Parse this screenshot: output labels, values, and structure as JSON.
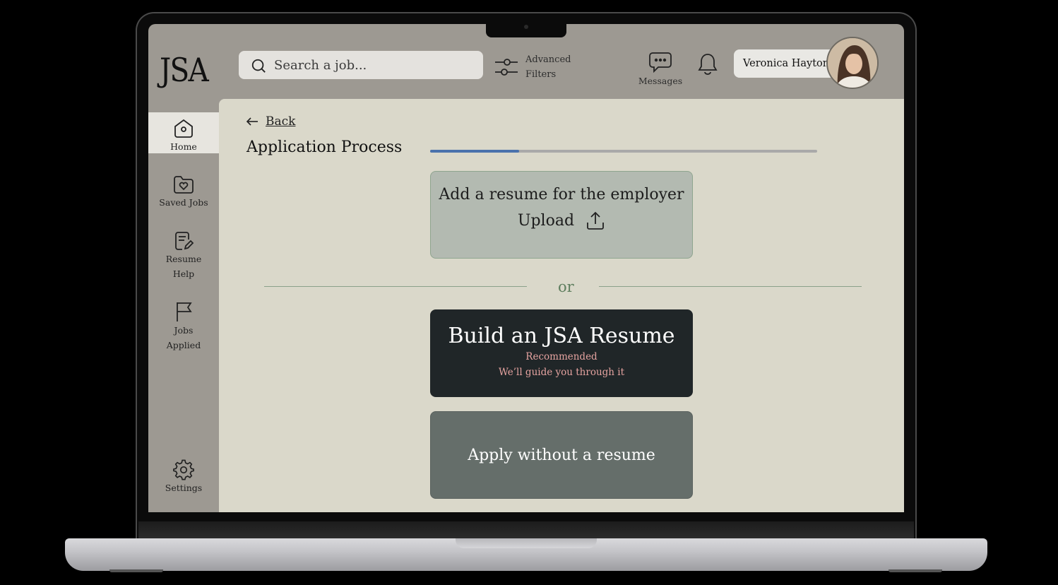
{
  "header": {
    "logo": "JSA",
    "search_placeholder": "Search a job...",
    "filters_line1": "Advanced",
    "filters_line2": "Filters",
    "messages_label": "Messages",
    "user_name": "Veronica Hayton"
  },
  "sidebar": {
    "items": [
      {
        "label": "Home",
        "icon": "home-icon",
        "active": true
      },
      {
        "label": "Saved Jobs",
        "icon": "folder-heart-icon"
      },
      {
        "label_line1": "Resume",
        "label_line2": "Help",
        "icon": "resume-edit-icon"
      },
      {
        "label_line1": "Jobs",
        "label_line2": "Applied",
        "icon": "flag-icon"
      }
    ],
    "settings_label": "Settings"
  },
  "main": {
    "back_label": "Back",
    "title": "Application Process",
    "progress": 0.23,
    "upload_card": {
      "heading": "Add a resume for the employer",
      "action": "Upload"
    },
    "divider_text": "or",
    "build_card": {
      "heading": "Build an JSA Resume",
      "tag": "Recommended",
      "subtext": "We’ll guide you through it"
    },
    "no_resume_card": {
      "label": "Apply without a resume"
    }
  },
  "colors": {
    "chrome": "#9d9992",
    "panel": "#dad8ca",
    "progress": "#4a72ac",
    "upload_card": "#b3bab1",
    "build_card": "#202628",
    "accent_text": "#e5a3a0",
    "no_resume_card": "#656e6a"
  }
}
